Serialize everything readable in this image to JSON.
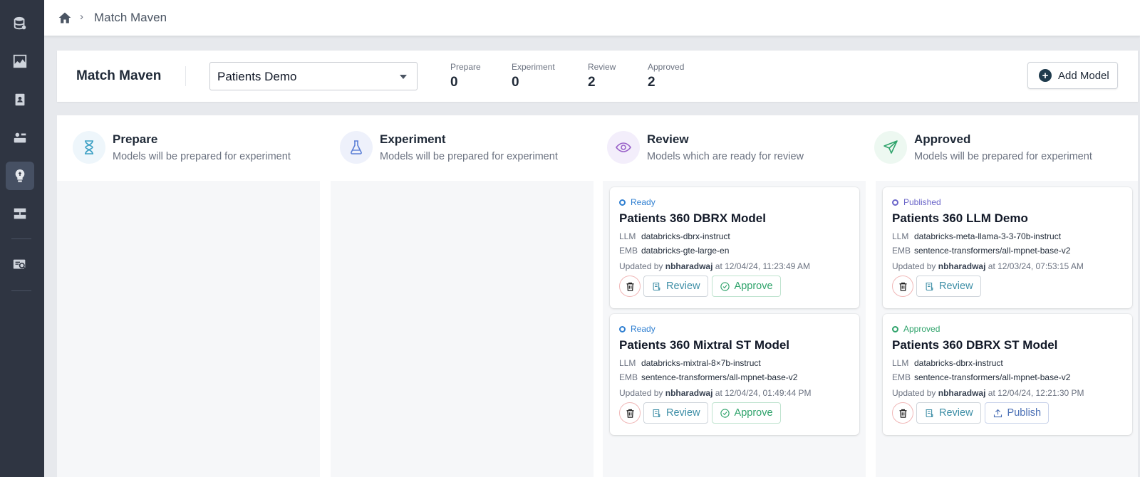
{
  "breadcrumb": {
    "current": "Match Maven",
    "separator": "›"
  },
  "header": {
    "title": "Match Maven",
    "project_select": "Patients Demo",
    "stats": [
      {
        "label": "Prepare",
        "value": "0"
      },
      {
        "label": "Experiment",
        "value": "0"
      },
      {
        "label": "Review",
        "value": "2"
      },
      {
        "label": "Approved",
        "value": "2"
      }
    ],
    "add_model_label": "Add Model"
  },
  "columns": [
    {
      "title": "Prepare",
      "subtitle": "Models will be prepared for experiment",
      "icon": "hourglass-icon"
    },
    {
      "title": "Experiment",
      "subtitle": "Models will be prepared for experiment",
      "icon": "flask-icon"
    },
    {
      "title": "Review",
      "subtitle": "Models which are ready for review",
      "icon": "eye-icon"
    },
    {
      "title": "Approved",
      "subtitle": "Models will be prepared for experiment",
      "icon": "send-icon"
    }
  ],
  "cards": {
    "review": [
      {
        "status": "Ready",
        "title": "Patients 360 DBRX Model",
        "llm_key": "LLM",
        "llm": "databricks-dbrx-instruct",
        "emb_key": "EMB",
        "emb": "databricks-gte-large-en",
        "updated_prefix": "Updated by",
        "user": "nbharadwaj",
        "updated_at": "at 12/04/24, 11:23:49 AM",
        "review_label": "Review",
        "approve_label": "Approve"
      },
      {
        "status": "Ready",
        "title": "Patients 360 Mixtral ST Model",
        "llm_key": "LLM",
        "llm": "databricks-mixtral-8×7b-instruct",
        "emb_key": "EMB",
        "emb": "sentence-transformers/all-mpnet-base-v2",
        "updated_prefix": "Updated by",
        "user": "nbharadwaj",
        "updated_at": "at 12/04/24, 01:49:44 PM",
        "review_label": "Review",
        "approve_label": "Approve"
      }
    ],
    "approved": [
      {
        "status": "Published",
        "title": "Patients 360 LLM Demo",
        "llm_key": "LLM",
        "llm": "databricks-meta-llama-3-3-70b-instruct",
        "emb_key": "EMB",
        "emb": "sentence-transformers/all-mpnet-base-v2",
        "updated_prefix": "Updated by",
        "user": "nbharadwaj",
        "updated_at": "at 12/03/24, 07:53:15 AM",
        "review_label": "Review"
      },
      {
        "status": "Approved",
        "title": "Patients 360 DBRX ST Model",
        "llm_key": "LLM",
        "llm": "databricks-dbrx-instruct",
        "emb_key": "EMB",
        "emb": "sentence-transformers/all-mpnet-base-v2",
        "updated_prefix": "Updated by",
        "user": "nbharadwaj",
        "updated_at": "at 12/04/24, 12:21:30 PM",
        "review_label": "Review",
        "publish_label": "Publish"
      }
    ]
  },
  "colors": {
    "sidebar": "#2f3542",
    "status_ready": "#2f7fd1",
    "status_published": "#6b66c9",
    "status_approved": "#2fa36b"
  }
}
